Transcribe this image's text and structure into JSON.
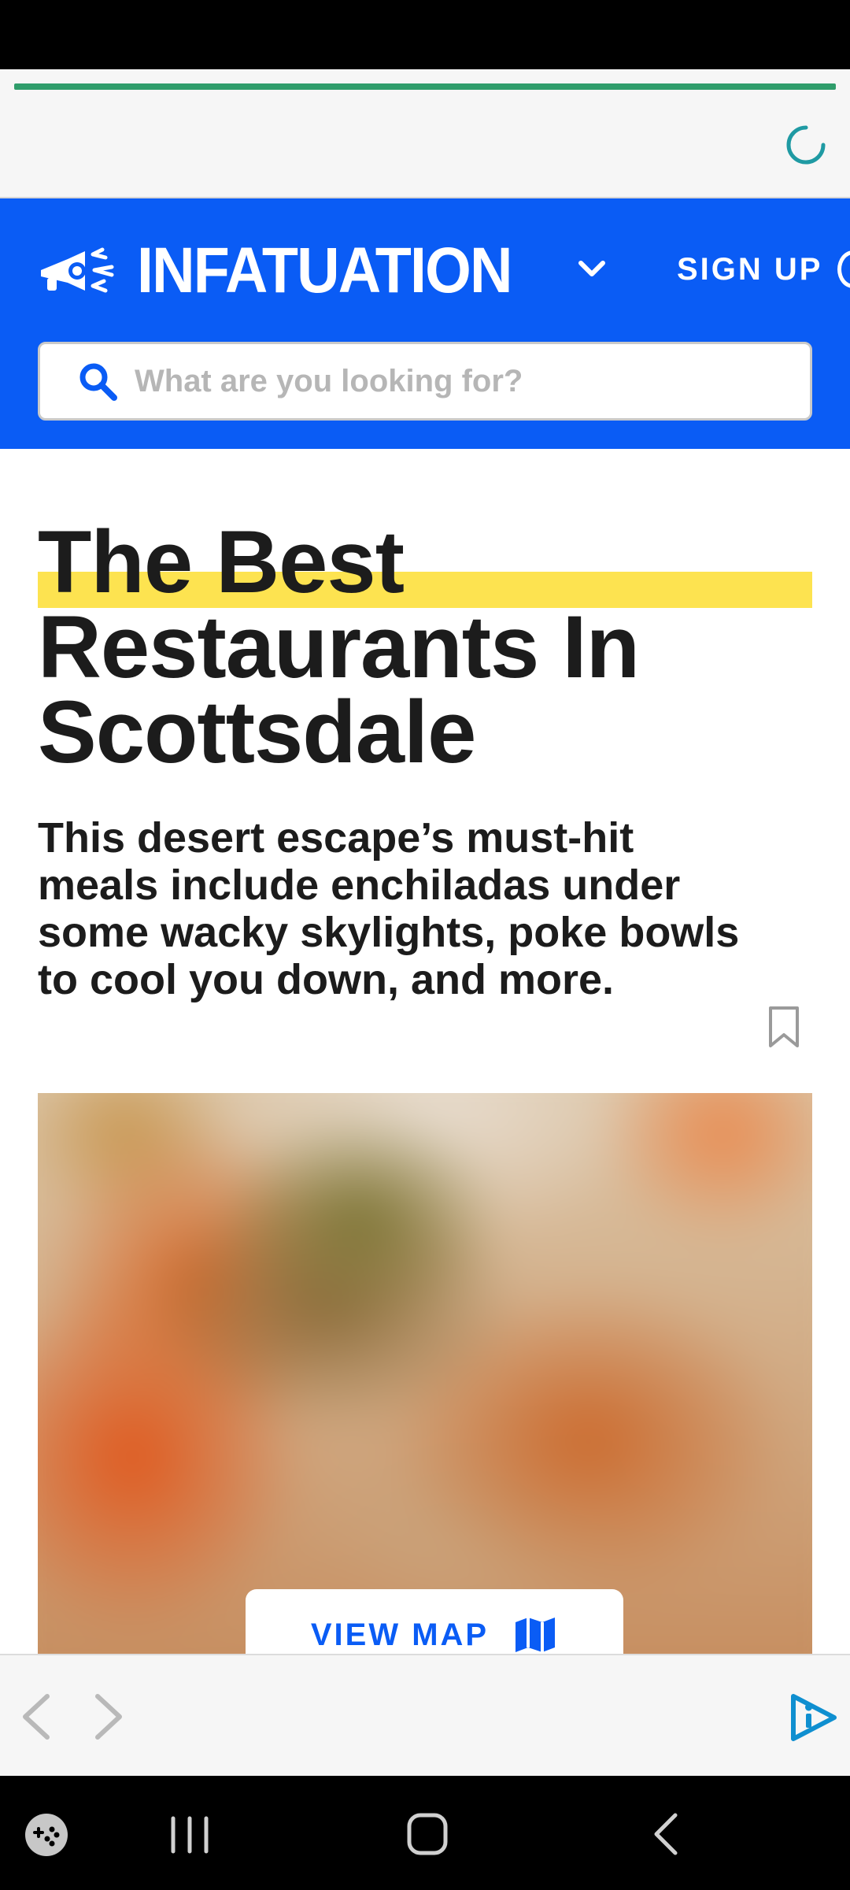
{
  "header": {
    "brand": "INFATUATION",
    "signup_label": "SIGN UP",
    "search_placeholder": "What are you looking for?"
  },
  "article": {
    "title_lines": [
      "The Best",
      "Restaurants In",
      "Scottsdale"
    ],
    "subtitle": "This desert escape’s must-hit meals include enchiladas under some wacky skylights, poke bowls to cool you down, and more.",
    "view_map_label": "VIEW MAP"
  },
  "colors": {
    "header_blue": "#0a5cf5",
    "highlight_yellow": "#fde350",
    "progress_green": "#2f9d6b",
    "spinner_teal": "#1f9aa3",
    "assistant_blue": "#0f8fd0"
  },
  "icons": {
    "logo": "megaphone-icon",
    "menu": "chevron-down-icon",
    "search": "search-icon",
    "save": "bookmark-icon",
    "map": "map-icon",
    "browser_back": "back-arrow-icon",
    "browser_forward": "forward-arrow-icon",
    "assistant": "assistant-icon",
    "system": [
      "game-icon",
      "recents-icon",
      "home-icon",
      "nav-back-icon"
    ]
  }
}
